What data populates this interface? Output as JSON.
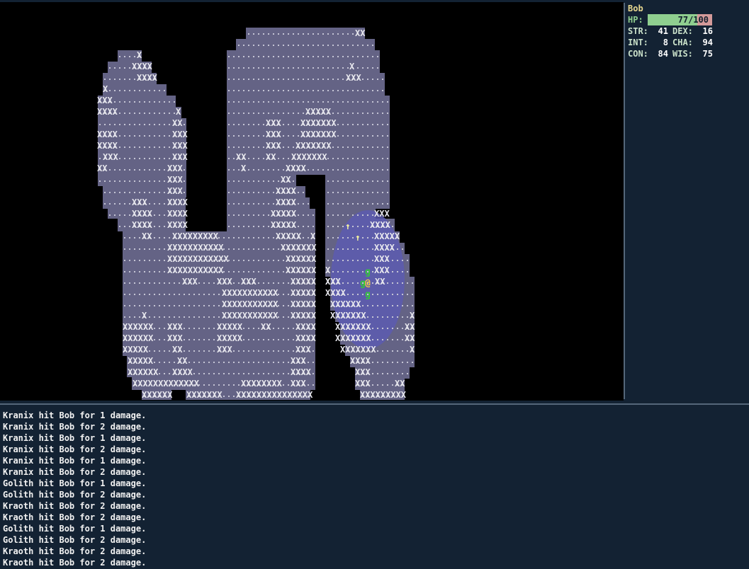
{
  "player": {
    "name": "Bob",
    "hp_label": "HP:",
    "hp_text": "77/100",
    "hp_current": 77,
    "hp_max": 100,
    "stats": [
      {
        "label": "STR:",
        "value": "41"
      },
      {
        "label": "DEX:",
        "value": "16"
      },
      {
        "label": "INT:",
        "value": "8"
      },
      {
        "label": "CHA:",
        "value": "94"
      },
      {
        "label": "CON:",
        "value": "84"
      },
      {
        "label": "WIS:",
        "value": "75"
      }
    ]
  },
  "map": {
    "player_glyph": "@",
    "monster_glyph": "g",
    "item_glyph": "↑",
    "wall_glyph": "X",
    "colors": {
      "floor": "#646385",
      "lit": "#5c5ab0",
      "wall_text": "#e8e8ee",
      "player": "#f5cf3c",
      "monster": "#35c83a",
      "item": "#f3f39a"
    }
  },
  "log": [
    "Kranix hit Bob for 1 damage.",
    "Kranix hit Bob for 2 damage.",
    "Kranix hit Bob for 1 damage.",
    "Kranix hit Bob for 2 damage.",
    "Kranix hit Bob for 1 damage.",
    "Kranix hit Bob for 2 damage.",
    "Golith hit Bob for 1 damage.",
    "Golith hit Bob for 2 damage.",
    "Kraoth hit Bob for 2 damage.",
    "Kraoth hit Bob for 2 damage.",
    "Golith hit Bob for 1 damage.",
    "Golith hit Bob for 2 damage.",
    "Kraoth hit Bob for 2 damage.",
    "Kraoth hit Bob for 2 damage."
  ]
}
